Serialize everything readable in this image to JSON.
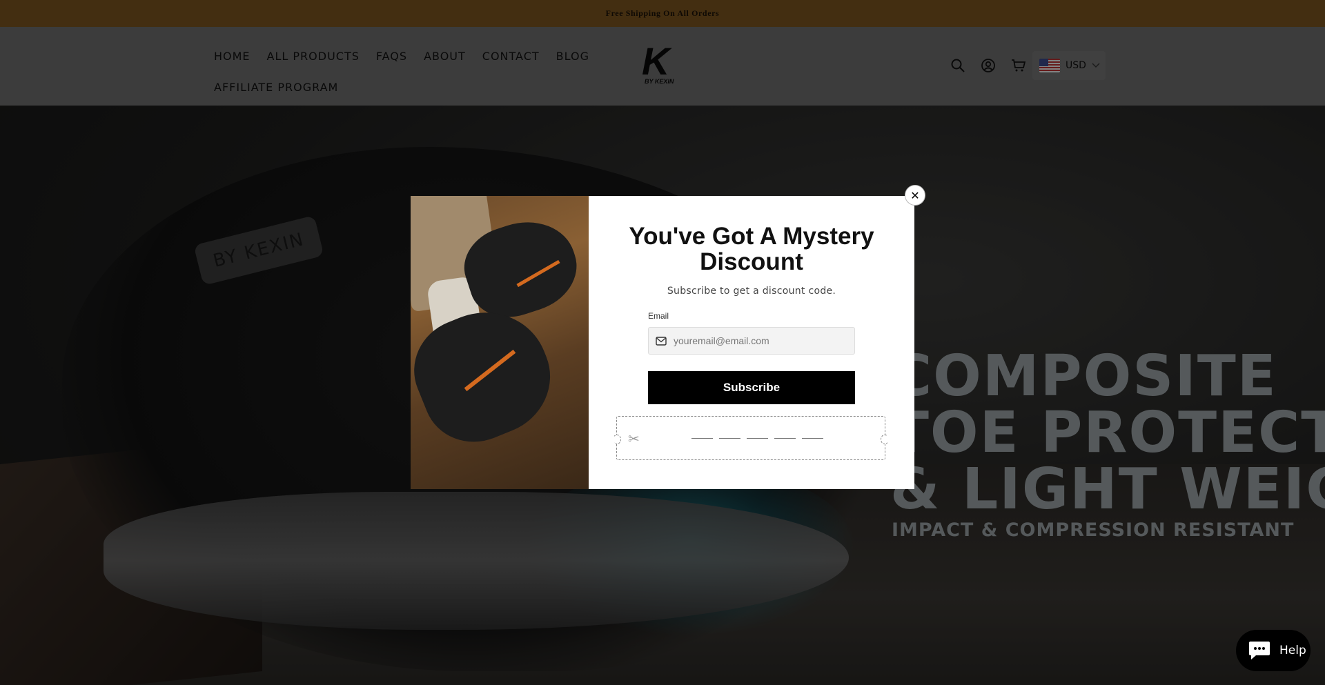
{
  "announcement": {
    "text": "Free Shipping On All Orders"
  },
  "nav": {
    "row1": [
      "HOME",
      "ALL PRODUCTS",
      "FAQS",
      "ABOUT",
      "CONTACT",
      "BLOG"
    ],
    "row2": [
      "AFFILIATE PROGRAM"
    ]
  },
  "logo": {
    "mark": "K",
    "sub": "BY KEXIN"
  },
  "header_icons": [
    "search-icon",
    "account-icon",
    "cart-icon"
  ],
  "currency": {
    "code": "USD",
    "flag": "us-flag-icon"
  },
  "hero": {
    "badge": "BY KEXIN",
    "headline_lines": [
      "COMPOSITE",
      "TOE PROTECTION",
      "& LIGHT WEIGHT"
    ],
    "subline": "IMPACT & COMPRESSION RESISTANT",
    "glow_color": "#23c8dc"
  },
  "popup": {
    "title": "You've Got A Mystery Discount",
    "subtitle": "Subscribe to get a discount code.",
    "email_label": "Email",
    "email_placeholder": "youremail@email.com",
    "subscribe_label": "Subscribe",
    "close_glyph": "✕",
    "coupon_scissors": "✂"
  },
  "help_widget": {
    "label": "Help"
  },
  "colors": {
    "announcement_bg": "#7a5420",
    "button_bg": "#000000",
    "overlay": "rgba(0,0,0,0.45)"
  }
}
